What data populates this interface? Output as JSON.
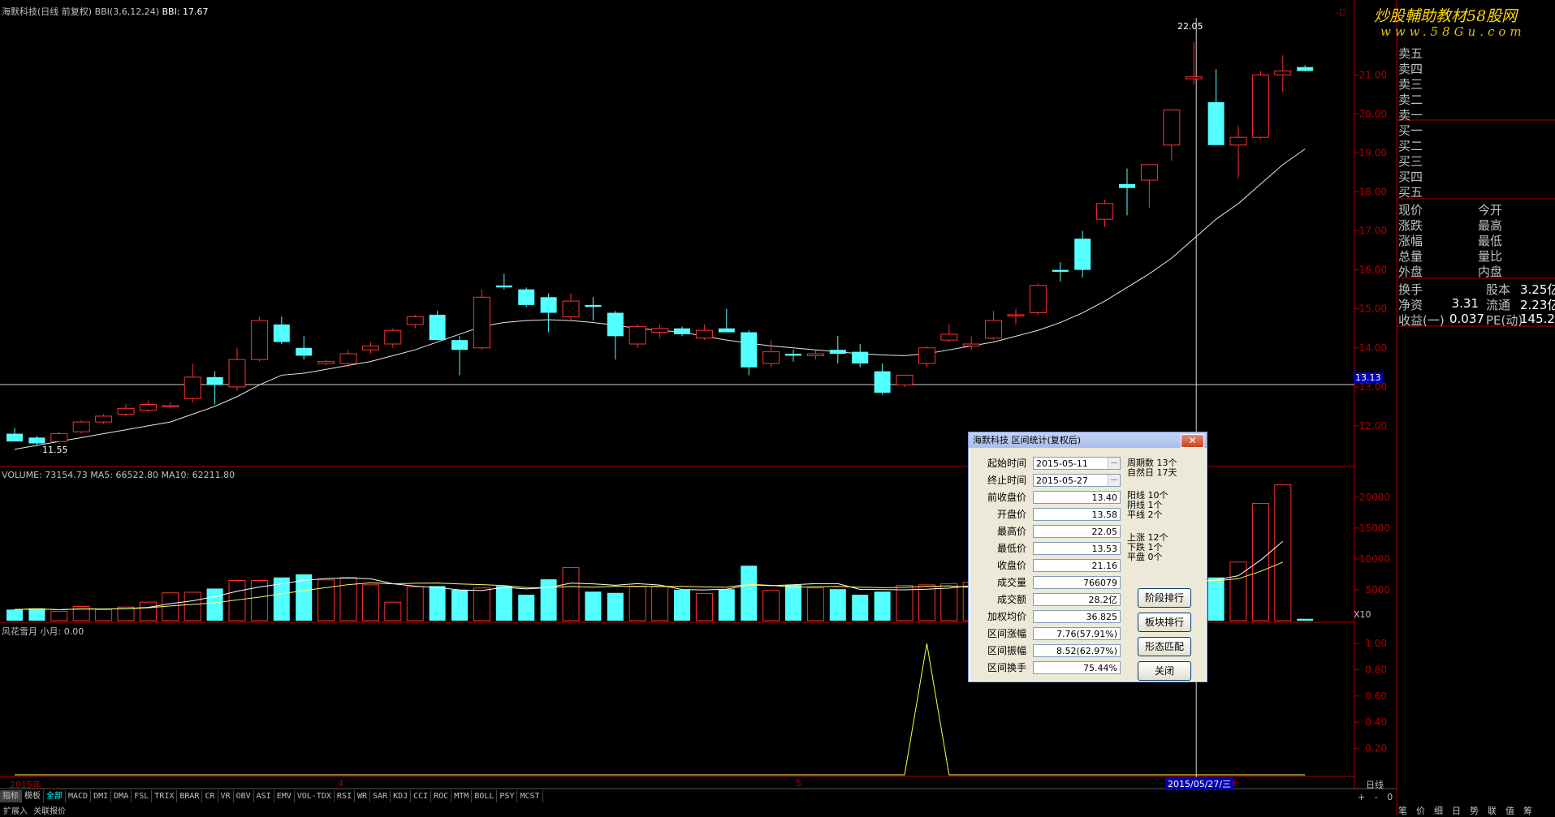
{
  "header": {
    "title": "海默科技(日线 前复权)",
    "indicator": "BBI(3,6,12,24)",
    "bbi_value": "BBI: 17.67",
    "watermark_top": "炒股輔助教材58股网",
    "watermark_bottom": "www.58Gu.com",
    "top_right_label": "-口"
  },
  "price_axis": {
    "labels": [
      "21.00",
      "20.00",
      "19.00",
      "18.00",
      "17.00",
      "16.00",
      "15.00",
      "14.00",
      "13.00",
      "12.00"
    ],
    "current_tag": "13.13",
    "high_mark": "22.05",
    "low_mark": "11.55"
  },
  "volume_panel": {
    "title": "VOLUME: 73154.73  MA5: 66522.80  MA10: 62211.80",
    "axis_labels": [
      "20000",
      "15000",
      "10000",
      "5000"
    ],
    "multiplier": "X10"
  },
  "indicator_panel": {
    "title": "风花雪月  小月: 0.00",
    "axis_labels": [
      "1.00",
      "0.80",
      "0.60",
      "0.40",
      "0.20"
    ]
  },
  "date_axis": {
    "start": "2015年",
    "m4": "4",
    "m5": "5",
    "cursor_date": "2015/05/27/三",
    "m6": "6",
    "period": "日线"
  },
  "quote_panel": {
    "sell": [
      "卖五",
      "卖四",
      "卖三",
      "卖二",
      "卖一"
    ],
    "buy": [
      "买一",
      "买二",
      "买三",
      "买四",
      "买五"
    ],
    "stats": [
      {
        "l": "现价",
        "r": "今开"
      },
      {
        "l": "涨跌",
        "r": "最高"
      },
      {
        "l": "涨幅",
        "r": "最低"
      },
      {
        "l": "总量",
        "r": "量比"
      },
      {
        "l": "外盘",
        "r": "内盘"
      }
    ],
    "fund": [
      {
        "a": "换手",
        "b": "",
        "c": "股本",
        "d": "3.25亿"
      },
      {
        "a": "净资",
        "b": "3.31",
        "c": "流通",
        "d": "2.23亿"
      },
      {
        "a": "收益(一)",
        "b": "0.037",
        "c": "PE(动)",
        "d": "145.2"
      }
    ]
  },
  "tabs": [
    "指标",
    "模板",
    "全部",
    "MACD",
    "DMI",
    "DMA",
    "FSL",
    "TRIX",
    "BRAR",
    "CR",
    "VR",
    "OBV",
    "ASI",
    "EMV",
    "VOL-TDX",
    "RSI",
    "WR",
    "SAR",
    "KDJ",
    "CCI",
    "ROC",
    "MTM",
    "BOLL",
    "PSY",
    "MCST"
  ],
  "bottom_tabs": [
    "扩展入",
    "关联报价"
  ],
  "bottom_right_tabs": [
    "笔",
    "价",
    "细",
    "日",
    "势",
    "联",
    "值",
    "筹"
  ],
  "zoom_controls": [
    "+",
    "-",
    "0"
  ],
  "dialog": {
    "title": "海默科技 区间统计(复权后)",
    "start_label": "起始时间",
    "start_value": "2015-05-11",
    "end_label": "终止时间",
    "end_value": "2015-05-27",
    "fields": [
      {
        "label": "前收盘价",
        "value": "13.40"
      },
      {
        "label": "开盘价",
        "value": "13.58"
      },
      {
        "label": "最高价",
        "value": "22.05"
      },
      {
        "label": "最低价",
        "value": "13.53"
      },
      {
        "label": "收盘价",
        "value": "21.16"
      },
      {
        "label": "成交量",
        "value": "766079"
      },
      {
        "label": "成交额",
        "value": "28.2亿"
      },
      {
        "label": "加权均价",
        "value": "36.825"
      },
      {
        "label": "区间涨幅",
        "value": "7.76(57.91%)"
      },
      {
        "label": "区间振幅",
        "value": "8.52(62.97%)"
      },
      {
        "label": "区间换手",
        "value": "75.44%"
      }
    ],
    "stats": [
      "周期数 13个",
      "自然日 17天",
      "阳线 10个",
      "阴线 1个",
      "平线 2个",
      "上涨 12个",
      "下跌 1个",
      "平盘 0个"
    ],
    "buttons": [
      "阶段排行",
      "板块排行",
      "形态匹配",
      "关闭"
    ]
  },
  "colors": {
    "up": "#ff3232",
    "down": "#54ffff",
    "axis": "#b00000",
    "text": "#c0c0c0"
  },
  "chart_data": {
    "type": "candlestick",
    "title": "海默科技(日线 前复权)",
    "ohlc": [
      [
        11.8,
        11.95,
        11.78,
        11.6
      ],
      [
        11.7,
        11.75,
        11.5,
        11.55
      ],
      [
        11.6,
        11.85,
        11.55,
        11.8
      ],
      [
        11.85,
        12.15,
        11.8,
        12.1
      ],
      [
        12.1,
        12.3,
        12.05,
        12.25
      ],
      [
        12.3,
        12.55,
        12.25,
        12.45
      ],
      [
        12.4,
        12.65,
        12.35,
        12.55
      ],
      [
        12.5,
        12.6,
        12.45,
        12.52
      ],
      [
        12.7,
        13.6,
        12.6,
        13.25
      ],
      [
        13.25,
        13.4,
        12.55,
        13.05
      ],
      [
        13.0,
        14.0,
        12.9,
        13.7
      ],
      [
        13.7,
        14.8,
        13.65,
        14.7
      ],
      [
        14.6,
        14.8,
        14.1,
        14.15
      ],
      [
        14.0,
        14.3,
        13.7,
        13.8
      ],
      [
        13.6,
        13.7,
        13.55,
        13.65
      ],
      [
        13.6,
        13.95,
        13.5,
        13.85
      ],
      [
        13.95,
        14.15,
        13.85,
        14.05
      ],
      [
        14.1,
        14.5,
        14.0,
        14.45
      ],
      [
        14.6,
        14.85,
        14.5,
        14.8
      ],
      [
        14.85,
        14.95,
        14.2,
        14.2
      ],
      [
        14.2,
        14.3,
        13.3,
        13.95
      ],
      [
        14.0,
        15.5,
        13.95,
        15.3
      ],
      [
        15.6,
        15.9,
        15.5,
        15.55
      ],
      [
        15.5,
        15.55,
        15.05,
        15.1
      ],
      [
        15.3,
        15.4,
        14.4,
        14.9
      ],
      [
        14.8,
        15.4,
        14.7,
        15.2
      ],
      [
        15.1,
        15.3,
        14.7,
        15.05
      ],
      [
        14.9,
        14.95,
        13.7,
        14.3
      ],
      [
        14.1,
        14.6,
        14.0,
        14.55
      ],
      [
        14.4,
        14.6,
        14.25,
        14.5
      ],
      [
        14.5,
        14.55,
        14.3,
        14.35
      ],
      [
        14.25,
        14.6,
        14.2,
        14.45
      ],
      [
        14.5,
        15.0,
        14.45,
        14.4
      ],
      [
        14.4,
        14.45,
        13.3,
        13.5
      ],
      [
        13.6,
        14.2,
        13.5,
        13.9
      ],
      [
        13.85,
        13.95,
        13.65,
        13.8
      ],
      [
        13.8,
        13.95,
        13.7,
        13.85
      ],
      [
        13.95,
        14.3,
        13.6,
        13.85
      ],
      [
        13.9,
        14.1,
        13.5,
        13.6
      ],
      [
        13.4,
        13.6,
        12.8,
        12.85
      ],
      [
        13.05,
        13.3,
        13.0,
        13.3
      ],
      [
        13.6,
        14.05,
        13.5,
        14.0
      ],
      [
        14.2,
        14.6,
        14.15,
        14.35
      ],
      [
        14.05,
        14.3,
        13.95,
        14.1
      ],
      [
        14.25,
        14.95,
        14.2,
        14.7
      ],
      [
        14.85,
        15.0,
        14.6,
        14.85
      ],
      [
        14.9,
        15.65,
        14.85,
        15.6
      ],
      [
        16.0,
        16.2,
        15.7,
        15.95
      ],
      [
        16.8,
        17.0,
        15.8,
        16.0
      ],
      [
        17.3,
        17.8,
        17.1,
        17.7
      ],
      [
        18.2,
        18.6,
        17.4,
        18.1
      ],
      [
        18.3,
        18.7,
        17.6,
        18.7
      ],
      [
        19.2,
        20.1,
        18.8,
        20.1
      ],
      [
        20.9,
        21.85,
        20.75,
        20.95
      ],
      [
        20.3,
        21.15,
        19.8,
        19.2
      ],
      [
        19.2,
        19.7,
        18.35,
        19.4
      ],
      [
        19.4,
        21.1,
        19.35,
        21.0
      ],
      [
        21.0,
        21.5,
        20.55,
        21.1
      ],
      [
        21.2,
        21.25,
        21.1,
        21.1
      ]
    ],
    "volume": [
      1800,
      2000,
      1500,
      2300,
      1800,
      2200,
      3000,
      4500,
      4600,
      5200,
      6500,
      6500,
      7000,
      7500,
      6600,
      7000,
      5800,
      3000,
      5500,
      5600,
      5000,
      5300,
      5600,
      4200,
      6700,
      8600,
      4700,
      4500,
      5500,
      5500,
      5000,
      4400,
      5100,
      8900,
      4900,
      5800,
      5300,
      5100,
      4200,
      4700,
      5700,
      5800,
      6000,
      6200,
      6300,
      6500,
      6900,
      7200,
      5500,
      5700,
      6100,
      6400,
      6800,
      6700,
      7000,
      9500,
      19000,
      22000,
      300
    ],
    "bbi": [
      11.4,
      11.5,
      11.6,
      11.7,
      11.8,
      11.9,
      12.0,
      12.1,
      12.3,
      12.5,
      12.75,
      13.05,
      13.3,
      13.35,
      13.45,
      13.55,
      13.65,
      13.8,
      13.95,
      14.15,
      14.35,
      14.55,
      14.65,
      14.7,
      14.72,
      14.7,
      14.65,
      14.58,
      14.5,
      14.45,
      14.4,
      14.3,
      14.2,
      14.12,
      14.05,
      14.0,
      13.95,
      13.9,
      13.85,
      13.82,
      13.8,
      13.85,
      13.95,
      14.05,
      14.15,
      14.3,
      14.45,
      14.65,
      14.9,
      15.2,
      15.55,
      15.9,
      16.3,
      16.8,
      17.3,
      17.7,
      18.2,
      18.7,
      19.1
    ],
    "signal": [
      0,
      0,
      0,
      0,
      0,
      0,
      0,
      0,
      0,
      0,
      0,
      0,
      0,
      0,
      0,
      0,
      0,
      0,
      0,
      0,
      0,
      0,
      0,
      0,
      0,
      0,
      0,
      0,
      0,
      0,
      0,
      0,
      0,
      0,
      0,
      0,
      0,
      0,
      0,
      0,
      0,
      1,
      0,
      0,
      0,
      0,
      0,
      0,
      0,
      0,
      0,
      0,
      0,
      0,
      0,
      0,
      0,
      0,
      0
    ],
    "x_labels": [
      "2015年",
      "4",
      "5",
      "6"
    ],
    "price_range": [
      11.0,
      22.4
    ],
    "volume_range": [
      0,
      23000
    ]
  }
}
